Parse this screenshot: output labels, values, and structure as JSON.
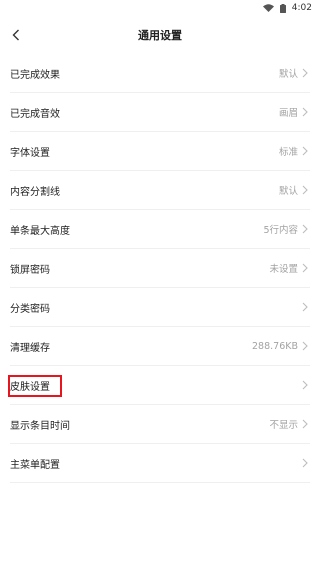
{
  "status": {
    "time": "4:02"
  },
  "header": {
    "title": "通用设置"
  },
  "settings": [
    {
      "label": "已完成效果",
      "value": "默认"
    },
    {
      "label": "已完成音效",
      "value": "画眉"
    },
    {
      "label": "字体设置",
      "value": "标准"
    },
    {
      "label": "内容分割线",
      "value": "默认"
    },
    {
      "label": "单条最大高度",
      "value": "5行内容"
    },
    {
      "label": "锁屏密码",
      "value": "未设置"
    },
    {
      "label": "分类密码",
      "value": ""
    },
    {
      "label": "清理缓存",
      "value": "288.76KB"
    },
    {
      "label": "皮肤设置",
      "value": ""
    },
    {
      "label": "显示条目时间",
      "value": "不显示"
    },
    {
      "label": "主菜单配置",
      "value": ""
    }
  ],
  "colors": {
    "highlight": "#e8141e",
    "value_text": "#a3a3a3",
    "divider": "#efefef"
  }
}
